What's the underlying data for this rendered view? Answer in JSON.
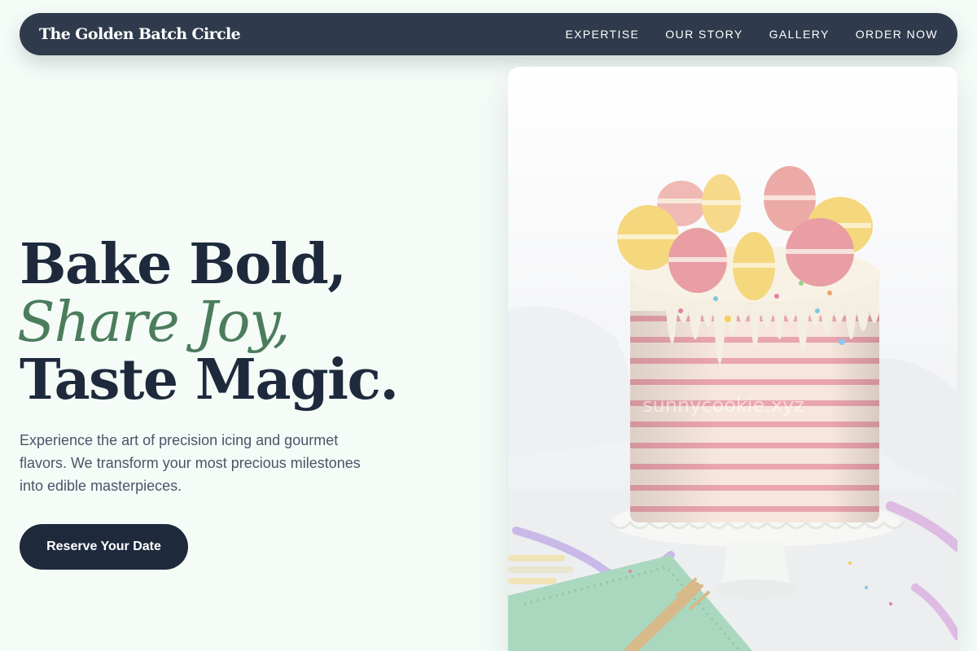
{
  "nav": {
    "brand": "The Golden Batch Circle",
    "links": [
      {
        "label": "EXPERTISE"
      },
      {
        "label": "OUR STORY"
      },
      {
        "label": "GALLERY"
      },
      {
        "label": "ORDER NOW"
      }
    ]
  },
  "hero": {
    "headline_line1": "Bake Bold,",
    "headline_line2": "Share Joy,",
    "headline_line3": "Taste Magic.",
    "description": "Experience the art of precision icing and gourmet flavors. We transform your most precious milestones into edible masterpieces.",
    "cta_label": "Reserve Your Date",
    "image_watermark": "sunnycookie.xyz"
  },
  "colors": {
    "page_background": "#f5fcf8",
    "nav_background": "#2f3b4c",
    "headline": "#1e2a3c",
    "accent_green": "#4b7d5c",
    "body_text": "#4a5568",
    "cta_background": "#1e2a3c"
  }
}
